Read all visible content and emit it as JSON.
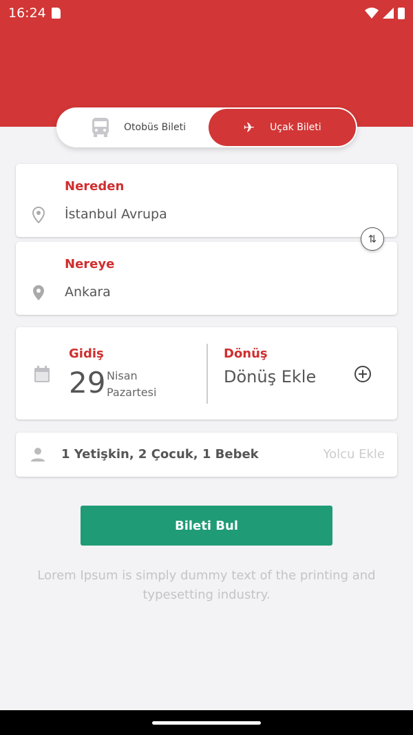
{
  "status": {
    "time": "16:24"
  },
  "toggle": {
    "bus_label": "Otobüs Bileti",
    "plane_label": "Uçak Bileti",
    "selected": "plane"
  },
  "from": {
    "label": "Nereden",
    "value": "İstanbul Avrupa"
  },
  "to": {
    "label": "Nereye",
    "value": "Ankara"
  },
  "departure": {
    "label": "Gidiş",
    "day": "29",
    "month": "Nisan",
    "weekday": "Pazartesi"
  },
  "return": {
    "label": "Dönüş",
    "value": "Dönüş Ekle"
  },
  "passengers": {
    "value": "1 Yetişkin, 2 Çocuk, 1 Bebek",
    "action": "Yolcu Ekle"
  },
  "search_button": "Bileti Bul",
  "description": "Lorem Ipsum is simply dummy text of the printing and typesetting industry.",
  "colors": {
    "brand": "#d23636",
    "button": "#1f9b76"
  }
}
